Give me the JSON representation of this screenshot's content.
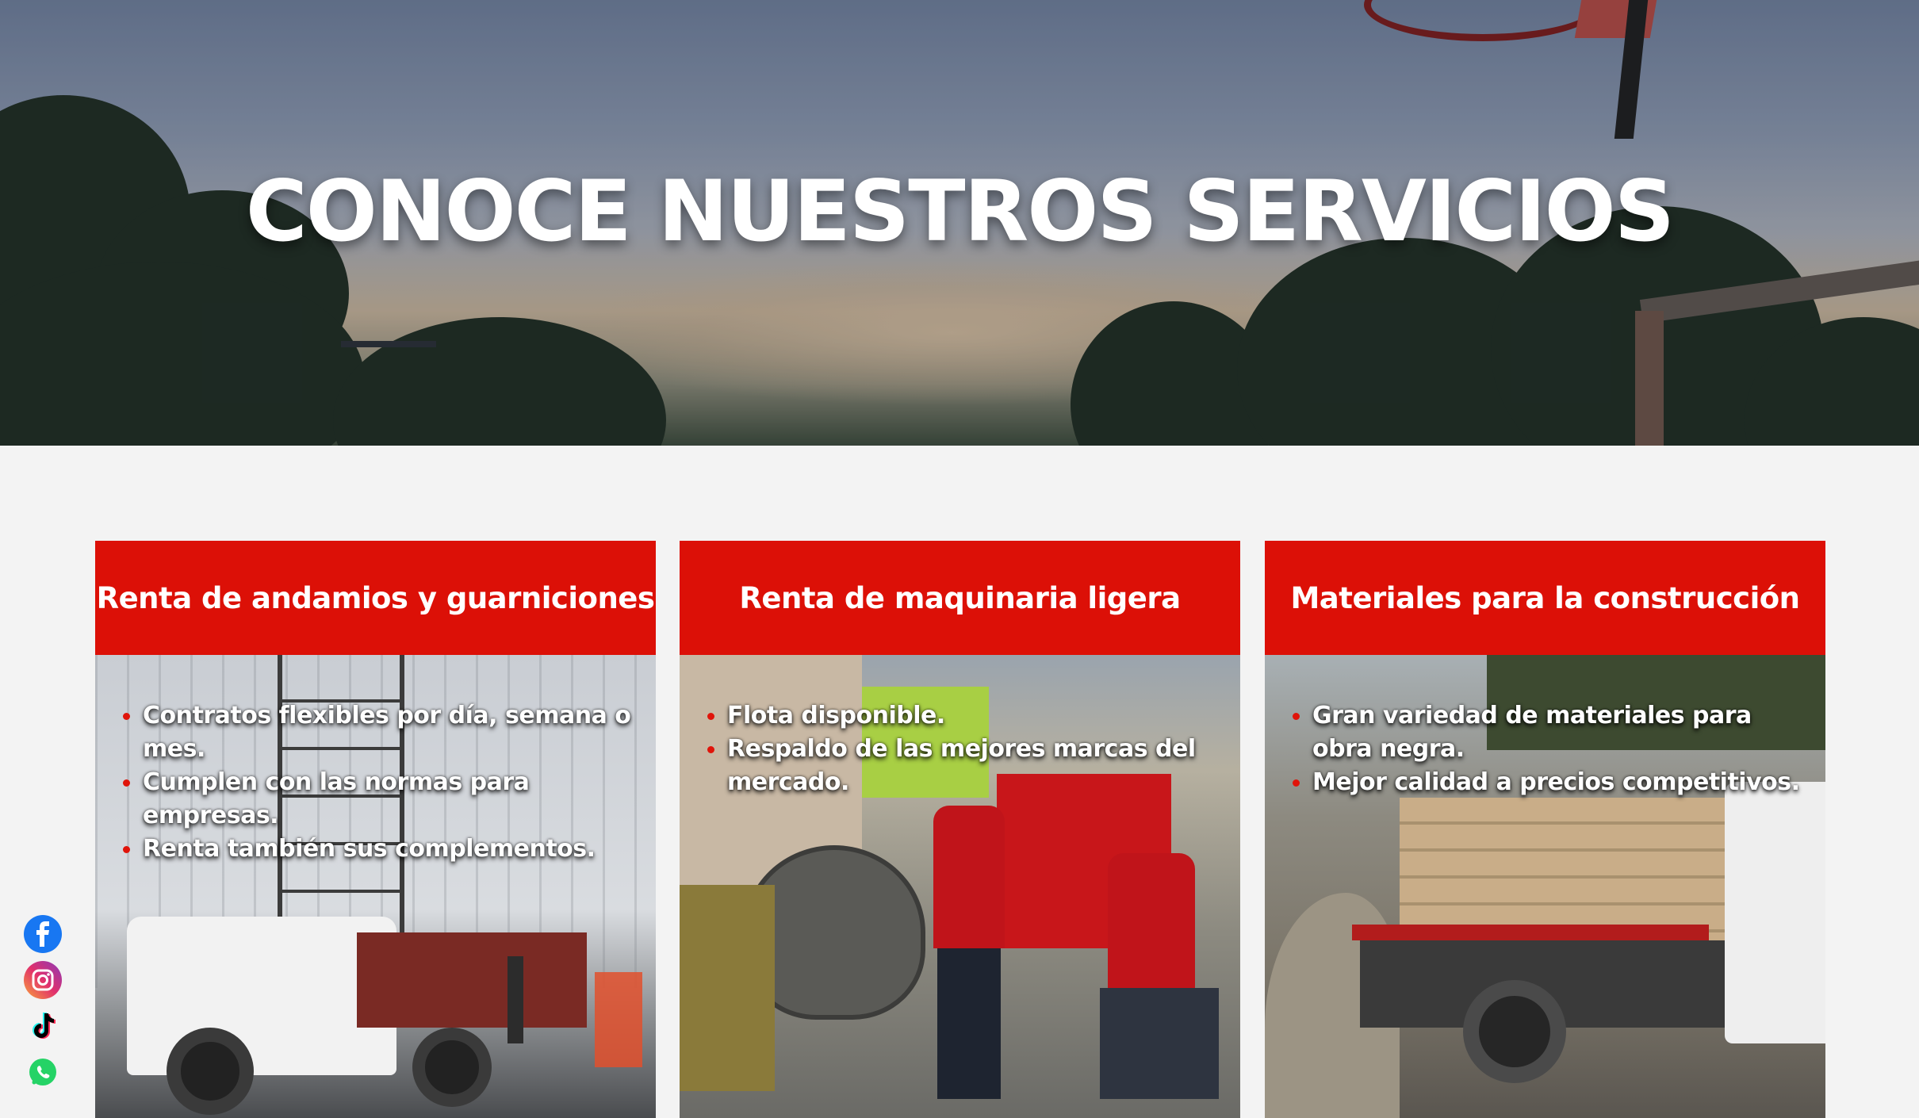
{
  "hero": {
    "title": "CONOCE NUESTROS SERVICIOS"
  },
  "cards": [
    {
      "title": "Renta de andamios y guarniciones",
      "items": [
        "Contratos flexibles por día, semana o mes.",
        "Cumplen con las normas para empresas.",
        "Renta también sus complementos."
      ]
    },
    {
      "title": "Renta de maquinaria ligera",
      "items": [
        "Flota disponible.",
        "Respaldo de las mejores marcas del mercado."
      ]
    },
    {
      "title": "Materiales para la construcción",
      "items": [
        "Gran variedad de materiales para obra negra.",
        "Mejor calidad a precios competitivos."
      ]
    }
  ],
  "social": [
    {
      "icon": "facebook-icon",
      "color": "#1877f2"
    },
    {
      "icon": "instagram-icon",
      "color": "#e1306c"
    },
    {
      "icon": "tiktok-icon",
      "color": "#000000"
    },
    {
      "icon": "whatsapp-icon",
      "color": "#25d366"
    }
  ],
  "colors": {
    "accent_red": "#dc1007",
    "page_bg": "#f3f3f3",
    "text_white": "#ffffff"
  }
}
